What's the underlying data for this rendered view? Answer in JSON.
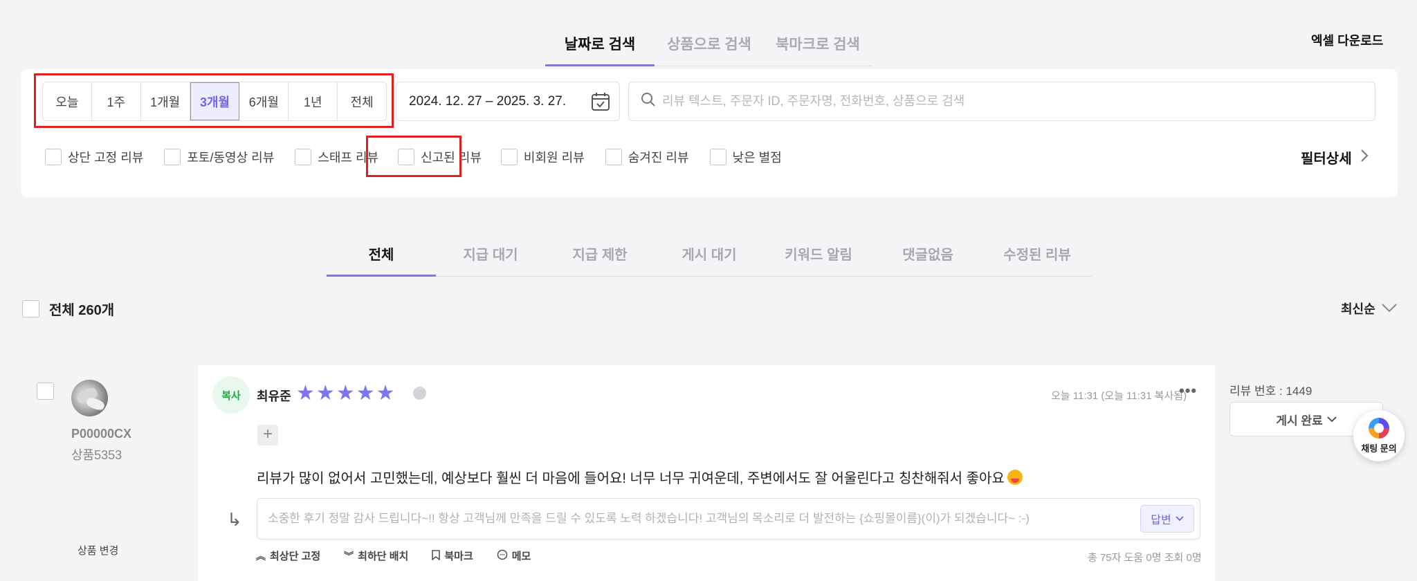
{
  "header": {
    "tabs": [
      "날짜로 검색",
      "상품으로 검색",
      "북마크로 검색"
    ],
    "active_tab": "날짜로 검색",
    "excel_download": "엑셀 다운로드"
  },
  "filters": {
    "periods": [
      "오늘",
      "1주",
      "1개월",
      "3개월",
      "6개월",
      "1년",
      "전체"
    ],
    "active_period": "3개월",
    "date_range": "2024. 12. 27 – 2025. 3. 27.",
    "search_placeholder": "리뷰 텍스트, 주문자 ID, 주문자명, 전화번호, 상품으로 검색",
    "checkboxes": [
      "상단 고정 리뷰",
      "포토/동영상 리뷰",
      "스태프 리뷰",
      "신고된 리뷰",
      "비회원 리뷰",
      "숨겨진 리뷰",
      "낮은 별점"
    ],
    "filter_detail": "필터상세"
  },
  "status_tabs": [
    "전체",
    "지급 대기",
    "지급 제한",
    "게시 대기",
    "키워드 알림",
    "댓글없음",
    "수정된 리뷰"
  ],
  "active_status_tab": "전체",
  "list": {
    "select_all_label": "전체 260개",
    "sort_label": "최신순"
  },
  "review": {
    "customer_id": "P00000CX",
    "product": "상품5353",
    "change_product": "상품 변경",
    "copy_badge": "복사",
    "reviewer": "최유준",
    "rating": 5,
    "timestamp": "오늘 11:31 (오늘 11:31 복사됨)",
    "text": "리뷰가 많이 없어서 고민했는데, 예상보다 훨씬 더 마음에 들어요! 너무 너무 귀여운데, 주변에서도 잘 어울린다고 칭찬해줘서 좋아요",
    "reply_placeholder": "소중한 후기 정말 감사 드립니다~!! 항상 고객님께 만족을 드릴 수 있도록 노력 하겠습니다! 고객님의 목소리로 더 발전하는 {쇼핑몰이름}(이)가 되겠습니다~ :-)",
    "reply_button": "답변",
    "actions": [
      "최상단 고정",
      "최하단 배치",
      "북마크",
      "메모"
    ],
    "stats": "총 75자  도움 0명  조회 0명",
    "review_number": "리뷰 번호 : 1449",
    "post_status": "게시 완료"
  },
  "chat": {
    "label": "채팅 문의"
  },
  "colors": {
    "accent": "#7b75f0",
    "highlight": "#e02020",
    "copy_green": "#24a84b"
  }
}
